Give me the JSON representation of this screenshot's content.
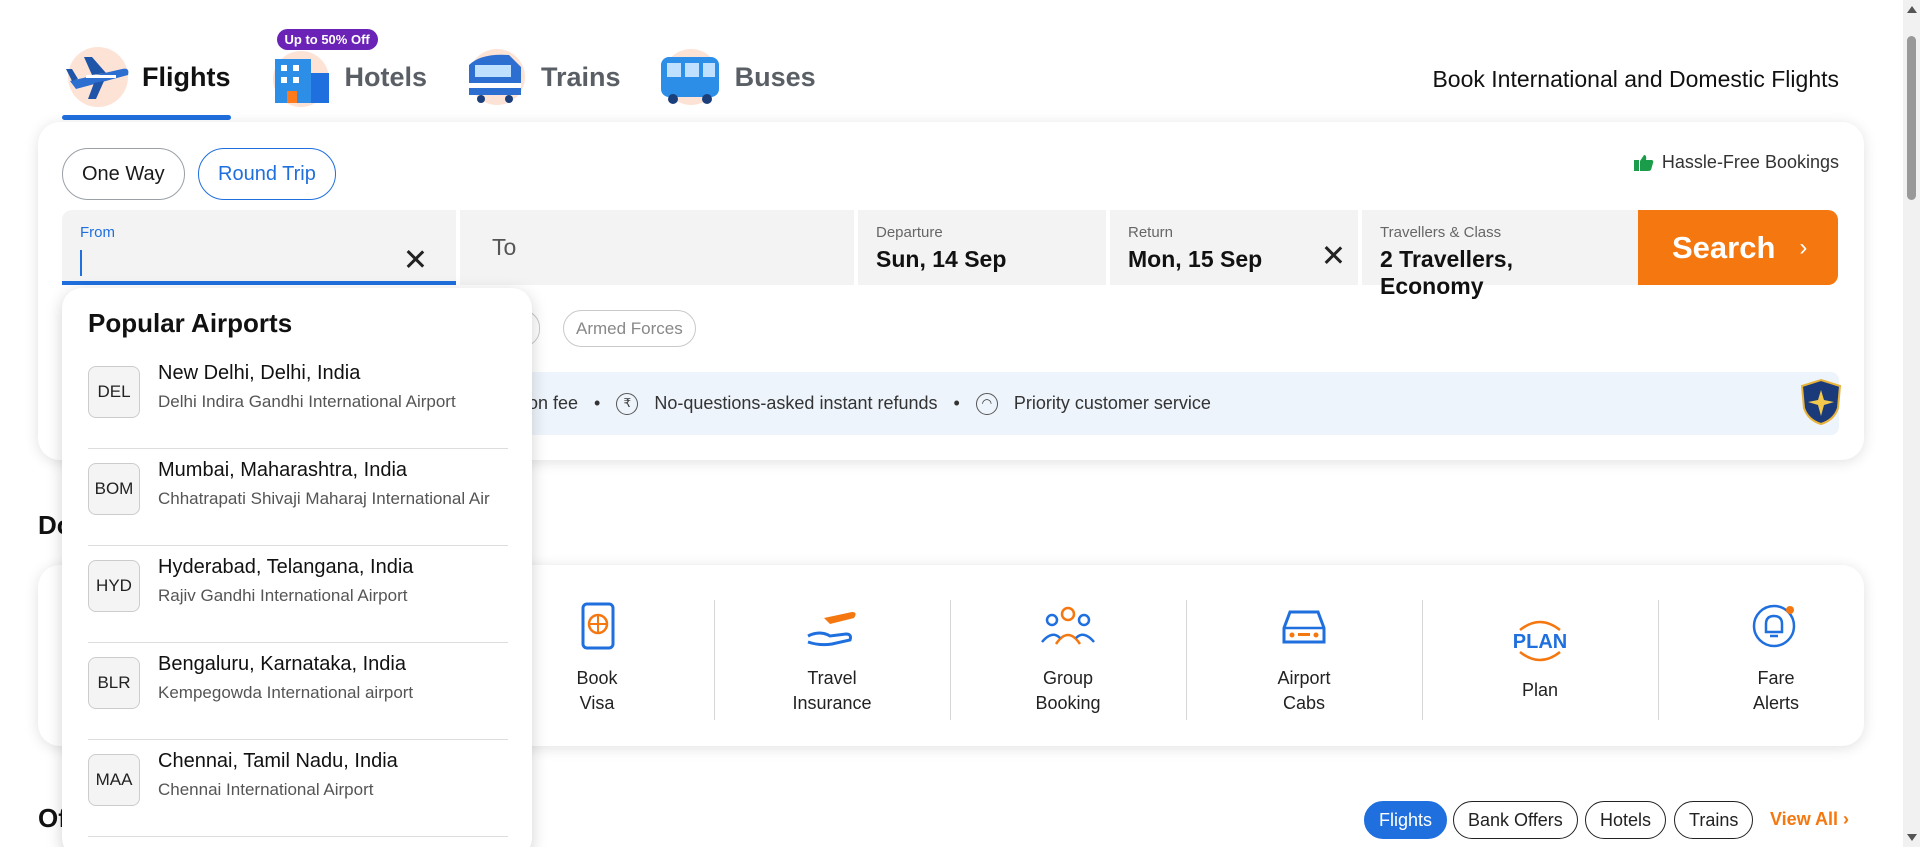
{
  "tabs": [
    {
      "label": "Flights",
      "icon": "airplane-icon",
      "active": true
    },
    {
      "label": "Hotels",
      "icon": "hotel-building-icon",
      "badge": "Up to 50% Off"
    },
    {
      "label": "Trains",
      "icon": "train-icon"
    },
    {
      "label": "Buses",
      "icon": "bus-icon"
    }
  ],
  "headline": "Book International and Domestic Flights",
  "trip_types": {
    "one_way": "One Way",
    "round_trip": "Round Trip",
    "selected": "Round Trip"
  },
  "hassle": "Hassle-Free Bookings",
  "search_form": {
    "from_label": "From",
    "from_value": "",
    "to_placeholder": "To",
    "departure_label": "Departure",
    "departure_value": "Sun, 14 Sep",
    "return_label": "Return",
    "return_value": "Mon, 15 Sep",
    "travellers_label": "Travellers & Class",
    "travellers_value": "2 Travellers, Economy",
    "search_button": "Search"
  },
  "special_fares": {
    "partial": "n",
    "armed_forces": "Armed Forces"
  },
  "perks": {
    "p1": "ion fee",
    "p2": "No-questions-asked instant refunds",
    "p3": "Priority customer service"
  },
  "sections": {
    "do_partial": "Do",
    "offers_partial": "Of"
  },
  "popular_airports": {
    "title": "Popular Airports",
    "items": [
      {
        "code": "DEL",
        "city": "New Delhi, Delhi, India",
        "airport": "Delhi Indira Gandhi International Airport"
      },
      {
        "code": "BOM",
        "city": "Mumbai, Maharashtra, India",
        "airport": "Chhatrapati Shivaji Maharaj International Air"
      },
      {
        "code": "HYD",
        "city": "Hyderabad, Telangana, India",
        "airport": "Rajiv Gandhi International Airport"
      },
      {
        "code": "BLR",
        "city": "Bengaluru, Karnataka, India",
        "airport": "Kempegowda International airport"
      },
      {
        "code": "MAA",
        "city": "Chennai, Tamil Nadu, India",
        "airport": "Chennai International Airport"
      }
    ]
  },
  "services": [
    {
      "label": "Book\nVisa",
      "icon": "passport-icon"
    },
    {
      "label": "Travel\nInsurance",
      "icon": "insurance-hand-plane-icon"
    },
    {
      "label": "Group\nBooking",
      "icon": "group-people-icon"
    },
    {
      "label": "Airport\nCabs",
      "icon": "cab-icon"
    },
    {
      "label": "Plan",
      "icon": "plan-icon"
    },
    {
      "label": "Fare\nAlerts",
      "icon": "bell-icon"
    }
  ],
  "offer_filters": [
    "Flights",
    "Bank Offers",
    "Hotels",
    "Trains"
  ],
  "offer_selected": "Flights",
  "view_all": "View All",
  "colors": {
    "accent": "#1f6fde",
    "search": "#f5770f",
    "badge": "#6b22b6"
  }
}
